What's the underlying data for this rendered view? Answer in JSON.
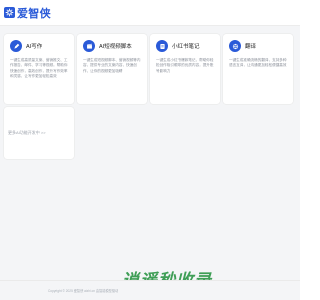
{
  "header": {
    "logo_text": "爱智侠",
    "logo_icon": "gear-icon"
  },
  "cards": [
    {
      "title": "AI写作",
      "desc": "一键生成高质量文案、营销推文、工作报告、邮件、学习等视频。帮助你快速创作，高效创作，提升写作效率和灵感，让写作更加轻松高效",
      "icon": "pen-icon",
      "icon_bg": "#2a5ad8"
    },
    {
      "title": "AI短视频脚本",
      "desc": "一键生成短视频脚本、营销视频等内容，提供专业的文案内容，快速创作，让你的视频更加吸睛",
      "icon": "clapper-icon",
      "icon_bg": "#2a5ad8"
    },
    {
      "title": "小红书笔记",
      "desc": "一键生成小红书爆款笔记，帮助你轻松创作吸引眼球的优质内容，提升账号影响力",
      "icon": "note-icon",
      "icon_bg": "#2a5ad8"
    },
    {
      "title": "翻译",
      "desc": "一键生成准确流畅的翻译，支持多种语言互译，让沟通更加轻松便捷高效",
      "icon": "translate-icon",
      "icon_bg": "#2a5ad8"
    }
  ],
  "more": {
    "label": "更多AI功能开发中 >>"
  },
  "footer": {
    "copyright": "Copyright © 2025 爱智侠 aizhi.cn 由智能模型驱动"
  },
  "watermark": {
    "text": "逍遥秒收录"
  }
}
